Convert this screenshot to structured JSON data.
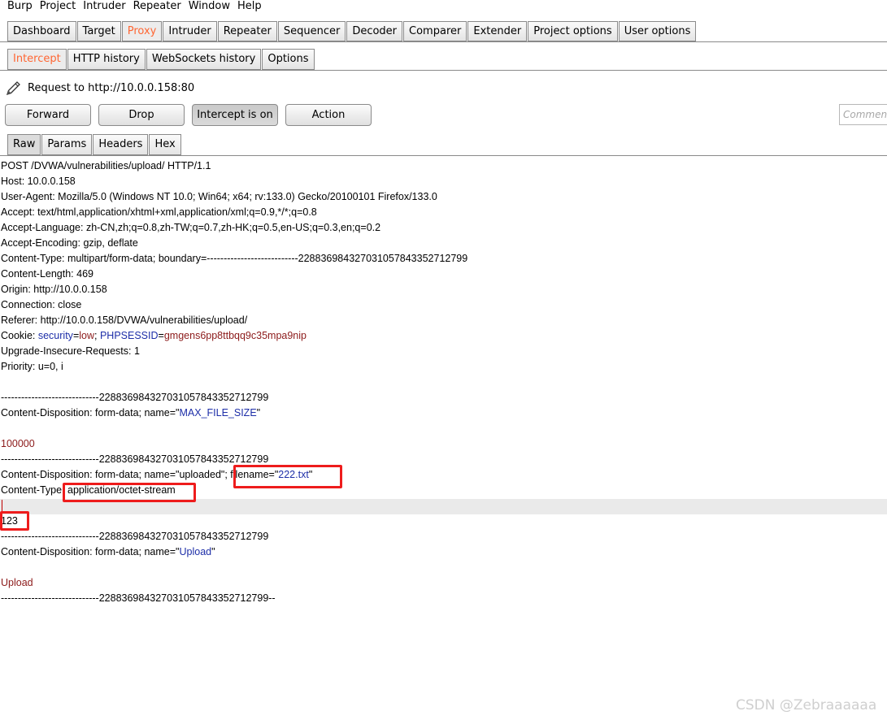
{
  "menu": [
    "Burp",
    "Project",
    "Intruder",
    "Repeater",
    "Window",
    "Help"
  ],
  "main_tabs": [
    "Dashboard",
    "Target",
    "Proxy",
    "Intruder",
    "Repeater",
    "Sequencer",
    "Decoder",
    "Comparer",
    "Extender",
    "Project options",
    "User options"
  ],
  "main_tab_active": "Proxy",
  "sub_tabs": [
    "Intercept",
    "HTTP history",
    "WebSockets history",
    "Options"
  ],
  "sub_tab_active": "Intercept",
  "request_info": "Request to http://10.0.0.158:80",
  "buttons": {
    "forward": "Forward",
    "drop": "Drop",
    "intercept": "Intercept is on",
    "action": "Action"
  },
  "comment_placeholder": "Comment",
  "view_tabs": [
    "Raw",
    "Params",
    "Headers",
    "Hex"
  ],
  "view_tab_active": "Raw",
  "request_lines": [
    "POST /DVWA/vulnerabilities/upload/ HTTP/1.1",
    "Host: 10.0.0.158",
    "User-Agent: Mozilla/5.0 (Windows NT 10.0; Win64; x64; rv:133.0) Gecko/20100101 Firefox/133.0",
    "Accept: text/html,application/xhtml+xml,application/xml;q=0.9,*/*;q=0.8",
    "Accept-Language: zh-CN,zh;q=0.8,zh-TW;q=0.7,zh-HK;q=0.5,en-US;q=0.3,en;q=0.2",
    "Accept-Encoding: gzip, deflate",
    "Content-Type: multipart/form-data; boundary=---------------------------228836984327031057843352712799",
    "Content-Length: 469",
    "Origin: http://10.0.0.158",
    "Connection: close",
    "Referer: http://10.0.0.158/DVWA/vulnerabilities/upload/",
    "Upgrade-Insecure-Requests: 1",
    "Priority: u=0, i"
  ],
  "cookie": {
    "label": "Cookie: ",
    "k1": "security",
    "eq1": "=",
    "v1": "low",
    "sep": "; ",
    "k2": "PHPSESSID",
    "eq2": "=",
    "v2": "gmgens6pp8ttbqq9c35mpa9nip"
  },
  "body": {
    "boundary": "-----------------------------228836984327031057843352712799",
    "boundary_end": "-----------------------------228836984327031057843352712799--",
    "disp_prefix": "Content-Disposition: form-data; name=\"",
    "quote": "\"",
    "name1": "MAX_FILE_SIZE",
    "value1": "100000",
    "name2_line_a": "Content-Disposition: form-data; name=\"uploaded\"; ",
    "filename_label": "filename=\"",
    "filename_value": "222.txt",
    "content_type_label": "Content-Type: ",
    "content_type_value": "application/octet-stream",
    "file_content": "123",
    "name3": "Upload",
    "value3": "Upload"
  },
  "watermark": "CSDN @Zebraaaaaa"
}
